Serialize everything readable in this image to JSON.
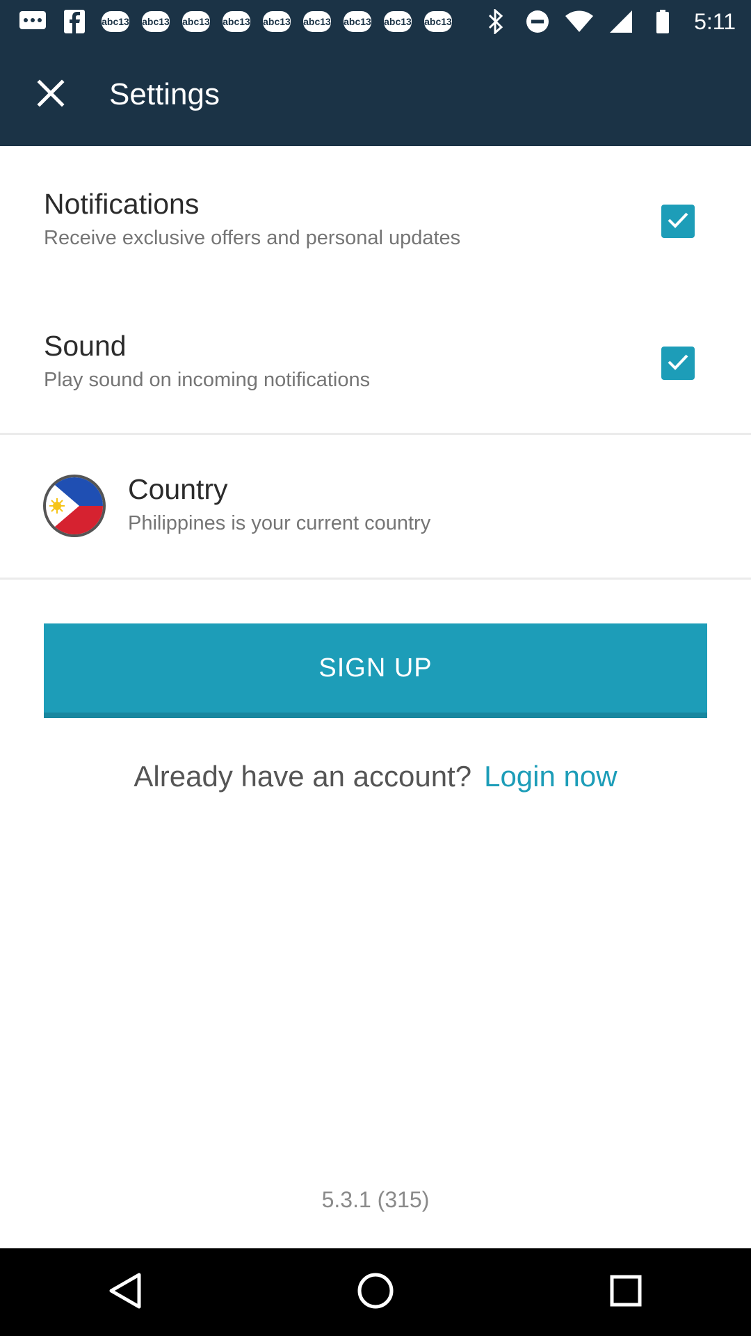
{
  "status_bar": {
    "time": "5:11",
    "icons": [
      "message-icon",
      "facebook-icon",
      "abc13-icon",
      "abc13-icon",
      "abc13-icon",
      "abc13-icon",
      "abc13-icon",
      "abc13-icon",
      "abc13-icon",
      "abc13-icon",
      "abc13-icon",
      "bluetooth-icon",
      "do-not-disturb-icon",
      "wifi-icon",
      "signal-icon",
      "battery-icon"
    ],
    "badge_text": "abc13"
  },
  "app_bar": {
    "title": "Settings",
    "close_icon": "close-icon"
  },
  "settings": {
    "notifications": {
      "title": "Notifications",
      "subtitle": "Receive exclusive offers and personal updates",
      "checked": true
    },
    "sound": {
      "title": "Sound",
      "subtitle": "Play sound on incoming notifications",
      "checked": true
    },
    "country": {
      "title": "Country",
      "subtitle": "Philippines is your current country",
      "flag_icon": "philippines-flag-icon"
    }
  },
  "signup": {
    "label": "SIGN UP"
  },
  "account": {
    "prompt": "Already have an account?",
    "login_label": "Login now"
  },
  "version": "5.3.1 (315)",
  "colors": {
    "header": "#1b3346",
    "accent": "#1d9db8"
  }
}
